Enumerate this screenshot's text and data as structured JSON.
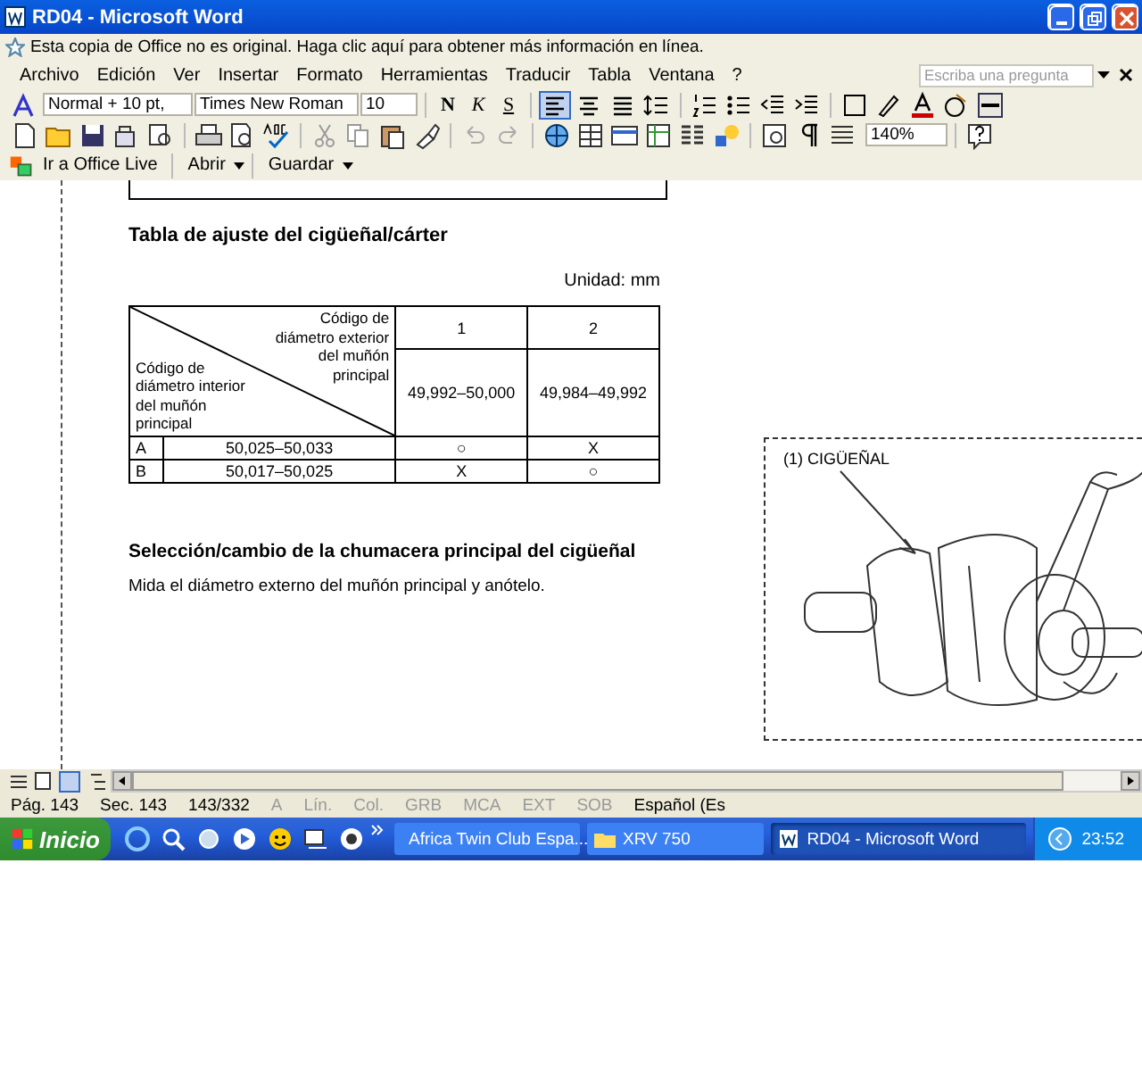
{
  "window": {
    "title": "RD04 - Microsoft Word"
  },
  "notice": "Esta copia de Office no es original.  Haga clic aquí para obtener más información en línea.",
  "menu": [
    "Archivo",
    "Edición",
    "Ver",
    "Insertar",
    "Formato",
    "Herramientas",
    "Traducir",
    "Tabla",
    "Ventana",
    "?"
  ],
  "help_search": {
    "placeholder": "Escriba una pregunta"
  },
  "formatting_toolbar": {
    "style": "Normal + 10 pt,",
    "font": "Times New Roman",
    "size": "10",
    "font_styles": [
      "N",
      "K",
      "S"
    ],
    "alignment": [
      {
        "selected": true
      },
      {
        "selected": false
      },
      {
        "selected": false
      }
    ]
  },
  "standard_toolbar": {
    "zoom": "140%"
  },
  "office_live_toolbar": {
    "buttons": [
      "Ir a Office Live",
      "Abrir",
      "Guardar"
    ]
  },
  "document": {
    "heading_1": "Tabla de ajuste del cigüeñal/cárter",
    "unit": "Unidad: mm",
    "table": {
      "corner_top": "Código de diámetro exterior del muñón principal",
      "corner_bottom": "Código de diámetro interior del muñón principal",
      "columns": [
        {
          "code": "1",
          "range": "49,992–50,000"
        },
        {
          "code": "2",
          "range": "49,984–49,992"
        }
      ],
      "rows": [
        {
          "code": "A",
          "range": "50,025–50,033",
          "cells": [
            "○",
            "X"
          ]
        },
        {
          "code": "B",
          "range": "50,017–50,025",
          "cells": [
            "X",
            "○"
          ]
        }
      ]
    },
    "heading_2": "Selección/cambio de la chumacera principal del cigüeñal",
    "paragraph": "Mida el diámetro externo del muñón principal y anótelo.",
    "figure": {
      "label": "(1) CIGÜEÑAL"
    }
  },
  "status_bar": [
    {
      "text": "Pág. 143",
      "disabled": false
    },
    {
      "text": "Sec. 143",
      "disabled": false
    },
    {
      "text": "143/332",
      "disabled": false
    },
    {
      "text": "A",
      "disabled": true
    },
    {
      "text": "Lín.",
      "disabled": true
    },
    {
      "text": "Col.",
      "disabled": true
    },
    {
      "text": "GRB",
      "disabled": true
    },
    {
      "text": "MCA",
      "disabled": true
    },
    {
      "text": "EXT",
      "disabled": true
    },
    {
      "text": "SOB",
      "disabled": true
    },
    {
      "text": "Español (Es",
      "disabled": false
    }
  ],
  "taskbar": {
    "start": "Inicio",
    "tasks": [
      {
        "label": "Africa Twin Club Espa...",
        "selected": false
      },
      {
        "label": "XRV 750",
        "selected": false
      },
      {
        "label": "RD04 - Microsoft Word",
        "selected": true
      }
    ],
    "clock": "23:52"
  }
}
